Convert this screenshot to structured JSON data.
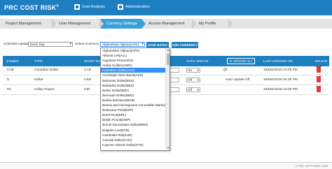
{
  "app": {
    "logo": "PRC COST RISK",
    "logo_mark": "®",
    "nav": [
      "Cost Analysis",
      "Administration"
    ]
  },
  "tabs": [
    "Project Management",
    "User Management",
    "Currency Settings",
    "Access Management",
    "My Profile"
  ],
  "filters": {
    "schedule_label": "Schedule Update",
    "schedule_value": "Every Day",
    "currency_label": "Select Currency",
    "currency_value": "Afghanistan Afghani(AFN)",
    "save_rates": "SAVE RATES",
    "add_currency": "ADD CURRENCY"
  },
  "table": {
    "headers": [
      "SYMBOL",
      "TYPE",
      "SHORT NAME",
      "AUTO UPDATE",
      "UPDATE ALL",
      "LAST UPDATED ON",
      "DELETE"
    ],
    "rows": [
      {
        "symbol": "CA$",
        "type": "Canadian Dollar",
        "short": "CAD",
        "auto": "On",
        "status": "",
        "updated": "18/Mar/2018 10:08 PM"
      },
      {
        "symbol": "$",
        "type": "Dollar",
        "short": "USD",
        "auto": "Off",
        "status": "Auto Update Off",
        "updated": "18/Mar/2018 06:36 PM"
      },
      {
        "symbol": "Rs",
        "type": "Indian Rupee",
        "short": "INR",
        "auto": "Off",
        "status": "",
        "updated": "18/Mar/2018 10:08 PM"
      }
    ]
  },
  "dropdown": {
    "items": [
      "Afghanistan Afghani(AFN)",
      "Albania Lek(ALL)",
      "Argentine Peso(ARS)",
      "Aruba Guilder(AWG)",
      "Australian Dollar(AUD)",
      "Azerbaijan New Manat(AZN)",
      "Bahamas Dollar(BSD)",
      "Barbados Dollar(BBD)",
      "Belize Dollar(BZD)",
      "Bermuda Dollar(BMD)",
      "Bolivia Boliviano(BOB)",
      "Bosnia and Herzegovina Convertible Marka(BAM)",
      "Botswana Pula(BWP)",
      "Brazil Real(BRL)",
      "British Pound(GBP)",
      "Brunei Darussalam Dollar(BND)",
      "Bulgaria Lev(BGN)",
      "Cambodia Riel(KHR)",
      "Canada Dollar(CAD)",
      "Cayman Islands Dollar(KYD)"
    ],
    "highlighted_index": 4
  },
  "footer": "© PRC SOFTWARE 2018",
  "colors": {
    "primary": "#1e7fc0",
    "active_tab": "#3aa0d8",
    "delete": "#e03b3b",
    "highlight": "#3390ff"
  }
}
